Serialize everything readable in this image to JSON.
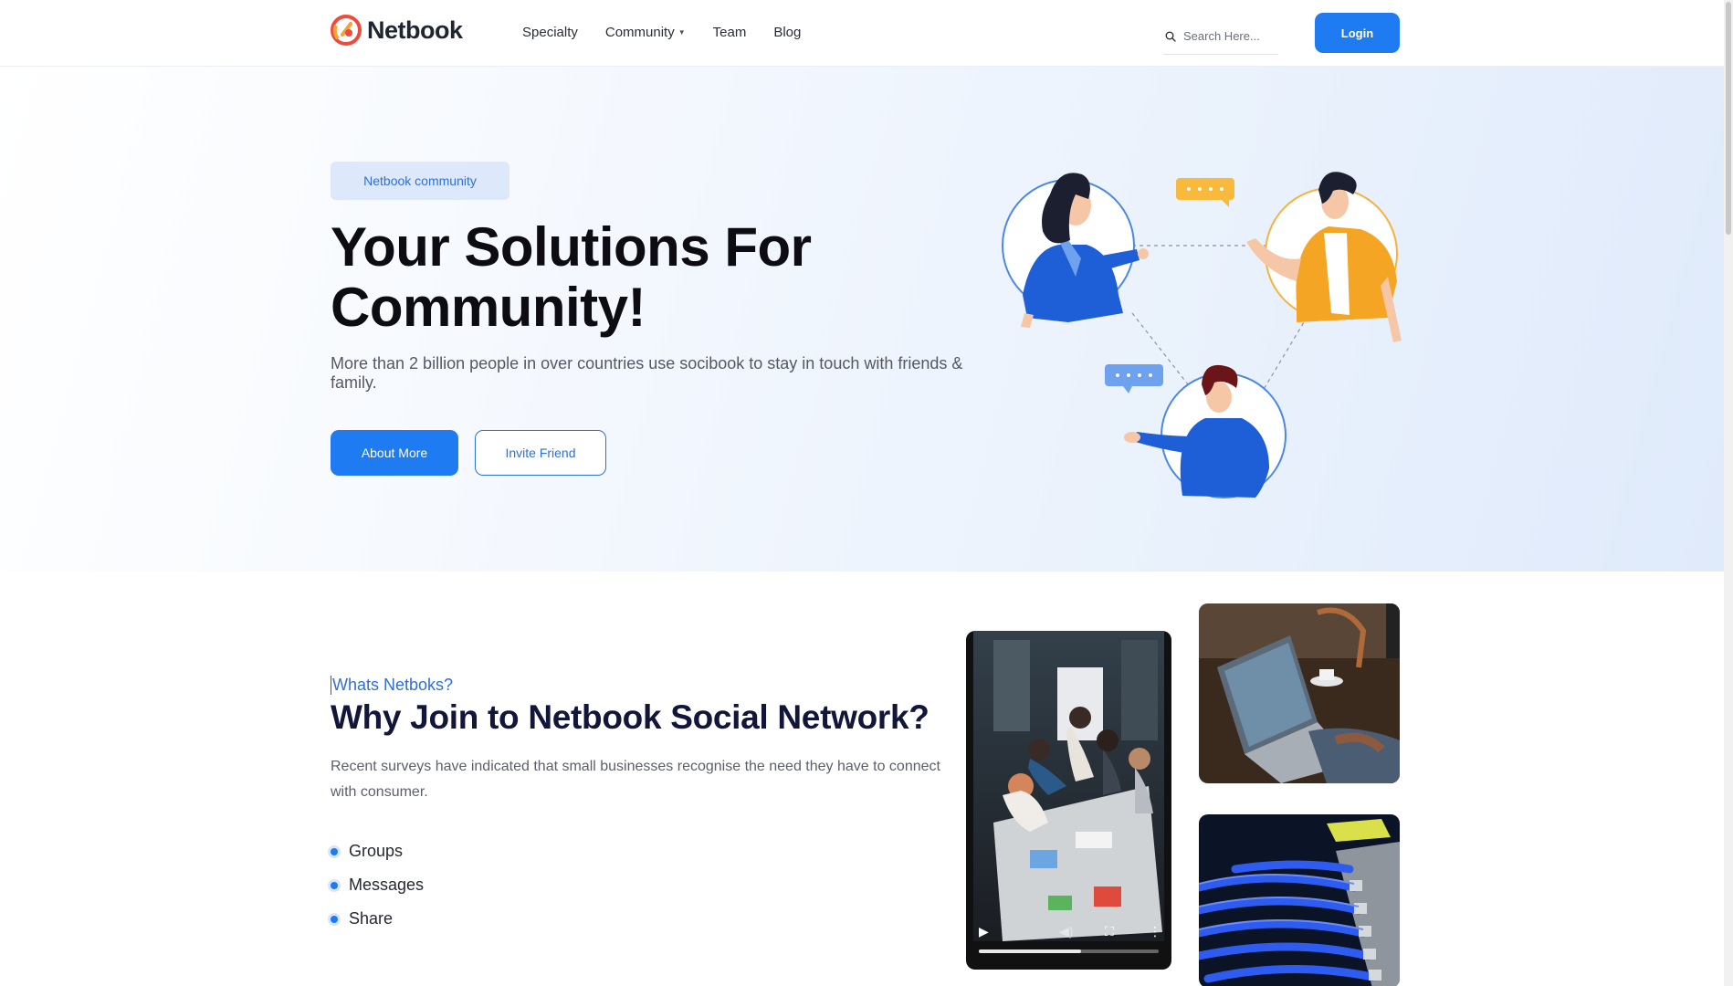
{
  "header": {
    "logo_text": "Netbook",
    "nav": [
      {
        "label": "Specialty",
        "has_dropdown": false
      },
      {
        "label": "Community",
        "has_dropdown": true
      },
      {
        "label": "Team",
        "has_dropdown": false
      },
      {
        "label": "Blog",
        "has_dropdown": false
      }
    ],
    "search_placeholder": "Search Here...",
    "login_label": "Login"
  },
  "hero": {
    "badge": "Netbook community",
    "title_line1": "Your Solutions For",
    "title_line2": "Community!",
    "subtitle": "More than 2 billion people in over countries use socibook to stay in touch with friends & family.",
    "primary_button": "About More",
    "secondary_button": "Invite Friend"
  },
  "about": {
    "kicker": "Whats Netboks?",
    "title": "Why Join to Netbook Social Network?",
    "text": "Recent surveys have indicated that small businesses recognise the need they have to connect with consumer.",
    "features": [
      "Groups",
      "Messages",
      "Share"
    ]
  },
  "video": {
    "progress": 0.57
  },
  "colors": {
    "accent": "#1e7bf2",
    "accent_text": "#2f6fd6",
    "heading_dark": "#12163a",
    "bubble_yellow": "#f9b93d"
  },
  "icons": {
    "logo": "netbook-logo-icon",
    "search": "search-icon",
    "caret": "chevron-down-icon",
    "video_play": "play-icon",
    "video_volume": "volume-icon",
    "video_fullscreen": "fullscreen-icon",
    "video_more": "more-vertical-icon"
  }
}
